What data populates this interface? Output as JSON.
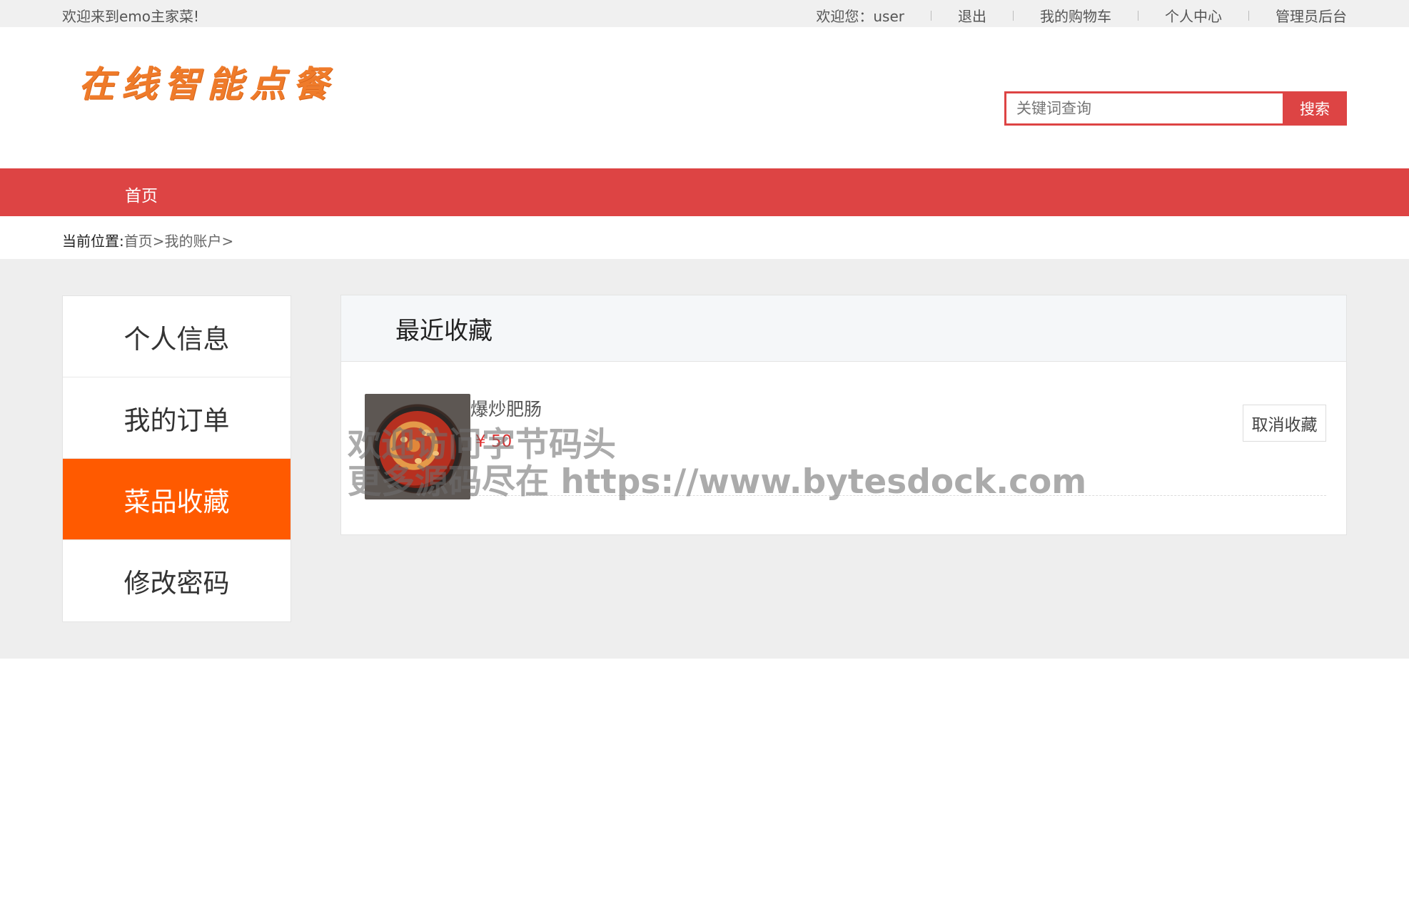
{
  "topbar": {
    "welcome": "欢迎来到emo主家菜!",
    "user_greeting": "欢迎您：user",
    "logout": "退出",
    "cart": "我的购物车",
    "profile_center": "个人中心",
    "admin": "管理员后台"
  },
  "header": {
    "logo_text": "在线智能点餐",
    "search_placeholder": "关键词查询",
    "search_button": "搜索"
  },
  "nav": {
    "items": [
      {
        "label": "首页"
      }
    ]
  },
  "breadcrumb": {
    "label": "当前位置:",
    "path": [
      "首页",
      "我的账户"
    ],
    "separator": ">"
  },
  "sidebar": {
    "items": [
      {
        "label": "个人信息",
        "active": false
      },
      {
        "label": "我的订单",
        "active": false
      },
      {
        "label": "菜品收藏",
        "active": true
      },
      {
        "label": "修改密码",
        "active": false
      }
    ]
  },
  "favorites": {
    "title": "最近收藏",
    "items": [
      {
        "name": "爆炒肥肠",
        "price": "¥ 50",
        "action": "取消收藏"
      }
    ]
  },
  "watermark": {
    "line1": "欢迎访问字节码头",
    "line2": "更多源码尽在  https://www.bytesdock.com"
  },
  "colors": {
    "brand_red": "#dd4444",
    "active_orange": "#ff5a00",
    "logo_orange": "#ef7b2a",
    "price_red": "#e03030"
  }
}
